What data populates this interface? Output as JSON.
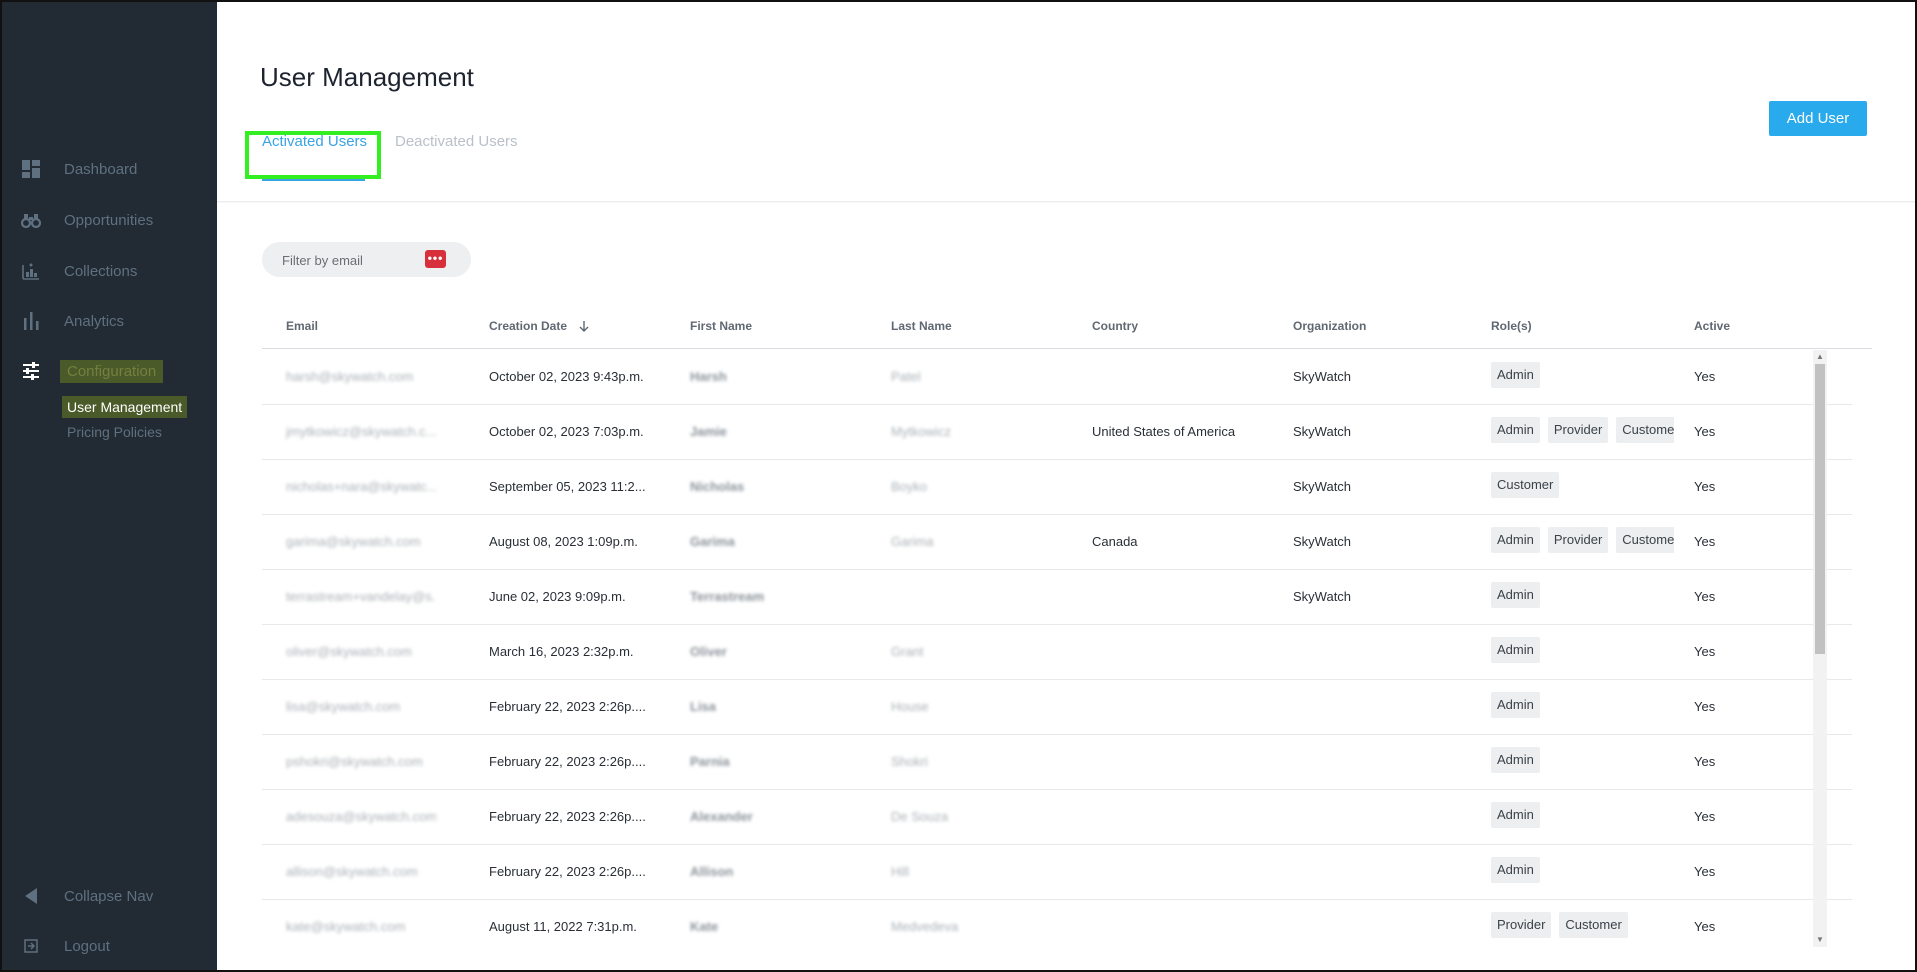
{
  "sidebar": {
    "items": [
      {
        "label": "Dashboard",
        "icon": "dashboard-icon"
      },
      {
        "label": "Opportunities",
        "icon": "binoculars-icon"
      },
      {
        "label": "Collections",
        "icon": "collections-icon"
      },
      {
        "label": "Analytics",
        "icon": "bar-chart-icon"
      },
      {
        "label": "Configuration",
        "icon": "sliders-icon"
      }
    ],
    "sub_items": [
      "User Management",
      "Pricing Policies"
    ],
    "collapse_label": "Collapse Nav",
    "logout_label": "Logout"
  },
  "header": {
    "title": "User Management",
    "tabs": [
      "Activated Users",
      "Deactivated Users"
    ],
    "add_button": "Add User"
  },
  "filter": {
    "placeholder": "Filter by email"
  },
  "table": {
    "columns": [
      "Email",
      "Creation Date",
      "First Name",
      "Last Name",
      "Country",
      "Organization",
      "Role(s)",
      "Active"
    ],
    "sort_icon": "arrow-down-icon",
    "rows": [
      {
        "email": "harsh@skywatch.com",
        "created": "October 02, 2023 9:43p.m.",
        "first": "Harsh",
        "last": "Patel",
        "country": "",
        "org": "SkyWatch",
        "roles": [
          "Admin"
        ],
        "active": "Yes"
      },
      {
        "email": "jmytkowicz@skywatch.c...",
        "created": "October 02, 2023 7:03p.m.",
        "first": "Jamie",
        "last": "Mytkowicz",
        "country": "United States of America",
        "org": "SkyWatch",
        "roles": [
          "Admin",
          "Provider",
          "Customer"
        ],
        "active": "Yes"
      },
      {
        "email": "nicholas+nara@skywatc...",
        "created": "September 05, 2023 11:2...",
        "first": "Nicholas",
        "last": "Boyko",
        "country": "",
        "org": "SkyWatch",
        "roles": [
          "Customer"
        ],
        "active": "Yes"
      },
      {
        "email": "garima@skywatch.com",
        "created": "August 08, 2023 1:09p.m.",
        "first": "Garima",
        "last": "Garima",
        "country": "Canada",
        "org": "SkyWatch",
        "roles": [
          "Admin",
          "Provider",
          "Customer"
        ],
        "active": "Yes"
      },
      {
        "email": "terrastream+vandelay@s...",
        "created": "June 02, 2023 9:09p.m.",
        "first": "Terrastream",
        "last": "",
        "country": "",
        "org": "SkyWatch",
        "roles": [
          "Admin"
        ],
        "active": "Yes"
      },
      {
        "email": "oliver@skywatch.com",
        "created": "March 16, 2023 2:32p.m.",
        "first": "Oliver",
        "last": "Grant",
        "country": "",
        "org": "",
        "roles": [
          "Admin"
        ],
        "active": "Yes"
      },
      {
        "email": "lisa@skywatch.com",
        "created": "February 22, 2023 2:26p....",
        "first": "Lisa",
        "last": "House",
        "country": "",
        "org": "",
        "roles": [
          "Admin"
        ],
        "active": "Yes"
      },
      {
        "email": "pshokri@skywatch.com",
        "created": "February 22, 2023 2:26p....",
        "first": "Parnia",
        "last": "Shokri",
        "country": "",
        "org": "",
        "roles": [
          "Admin"
        ],
        "active": "Yes"
      },
      {
        "email": "adesouza@skywatch.com",
        "created": "February 22, 2023 2:26p....",
        "first": "Alexander",
        "last": "De Souza",
        "country": "",
        "org": "",
        "roles": [
          "Admin"
        ],
        "active": "Yes"
      },
      {
        "email": "allison@skywatch.com",
        "created": "February 22, 2023 2:26p....",
        "first": "Allison",
        "last": "Hill",
        "country": "",
        "org": "",
        "roles": [
          "Admin"
        ],
        "active": "Yes"
      },
      {
        "email": "kate@skywatch.com",
        "created": "August 11, 2022 7:31p.m.",
        "first": "Kate",
        "last": "Medvedeva",
        "country": "",
        "org": "",
        "roles": [
          "Provider",
          "Customer"
        ],
        "active": "Yes"
      }
    ]
  },
  "colors": {
    "sidebar_bg": "#222b33",
    "accent": "#29aaec",
    "highlight": "#33ef22",
    "active_nav_bg": "#4a5a28"
  }
}
